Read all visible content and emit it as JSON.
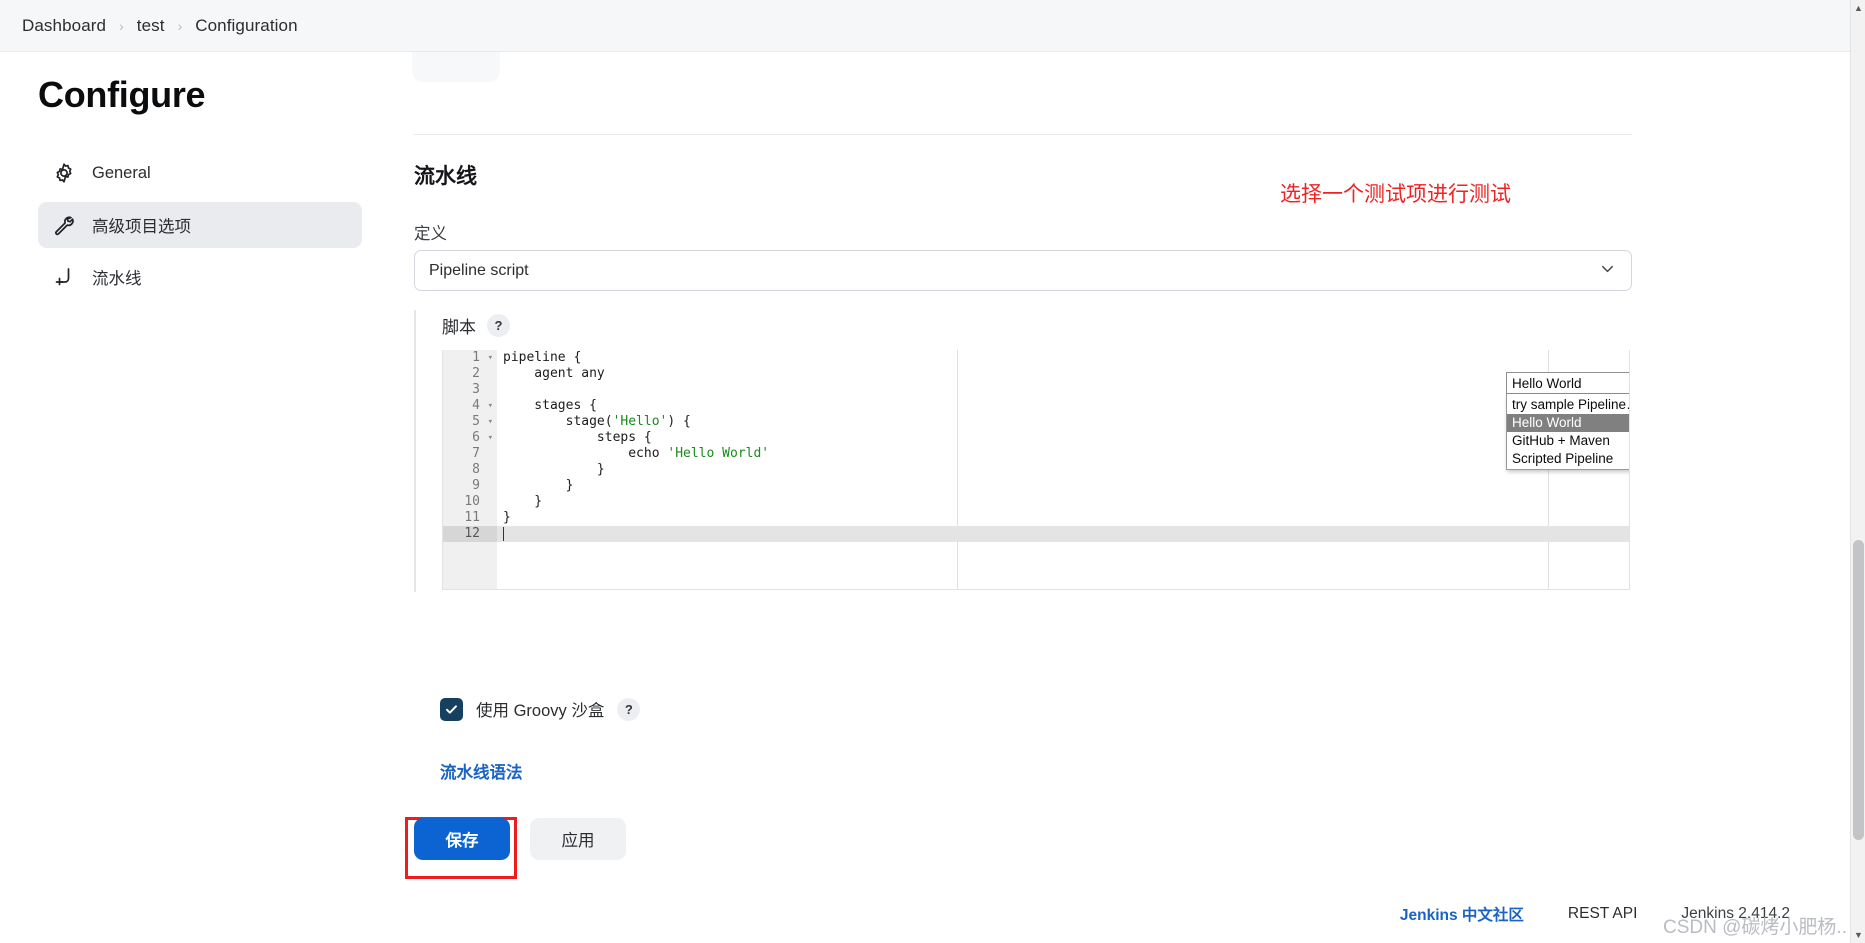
{
  "breadcrumb": {
    "items": [
      "Dashboard",
      "test",
      "Configuration"
    ],
    "separator": "›"
  },
  "sidebar": {
    "title": "Configure",
    "items": [
      {
        "label": "General",
        "icon": "gear-icon",
        "active": false
      },
      {
        "label": "高级项目选项",
        "icon": "wrench-icon",
        "active": true
      },
      {
        "label": "流水线",
        "icon": "pipeline-icon",
        "active": false
      }
    ]
  },
  "main": {
    "section_title": "流水线",
    "red_note": "选择一个测试项进行测试",
    "definition": {
      "label": "定义",
      "value": "Pipeline script",
      "chevron": "chevron-down-icon"
    },
    "script": {
      "label": "脚本",
      "help": "?",
      "line_numbers": [
        "1",
        "2",
        "3",
        "4",
        "5",
        "6",
        "7",
        "8",
        "9",
        "10",
        "11",
        "12"
      ],
      "fold_rows": [
        1,
        4,
        5,
        6
      ],
      "current_line": 12,
      "code_lines": [
        "pipeline {",
        "    agent any",
        "",
        "    stages {",
        "        stage('Hello') {",
        "            steps {",
        "                echo 'Hello World'",
        "            }",
        "        }",
        "    }",
        "}",
        ""
      ]
    },
    "sample_select": {
      "value": "Hello World",
      "options": [
        "try sample Pipeline…",
        "Hello World",
        "GitHub + Maven",
        "Scripted Pipeline"
      ],
      "selected_index": 1
    },
    "sandbox": {
      "label": "使用 Groovy 沙盒",
      "checked": true,
      "help": "?"
    },
    "syntax_link": "流水线语法",
    "buttons": {
      "save": "保存",
      "apply": "应用"
    }
  },
  "footer": {
    "community_link": "Jenkins 中文社区",
    "rest_api": "REST API",
    "version": "Jenkins 2.414.2",
    "watermark": "CSDN @碳烤小肥杨.."
  },
  "colors": {
    "accent_blue": "#0b64d2",
    "link_blue": "#1a63c4",
    "annotation_red": "#ee1c1c",
    "checkbox_navy": "#15405f",
    "string_green": "#1a8a1a"
  }
}
